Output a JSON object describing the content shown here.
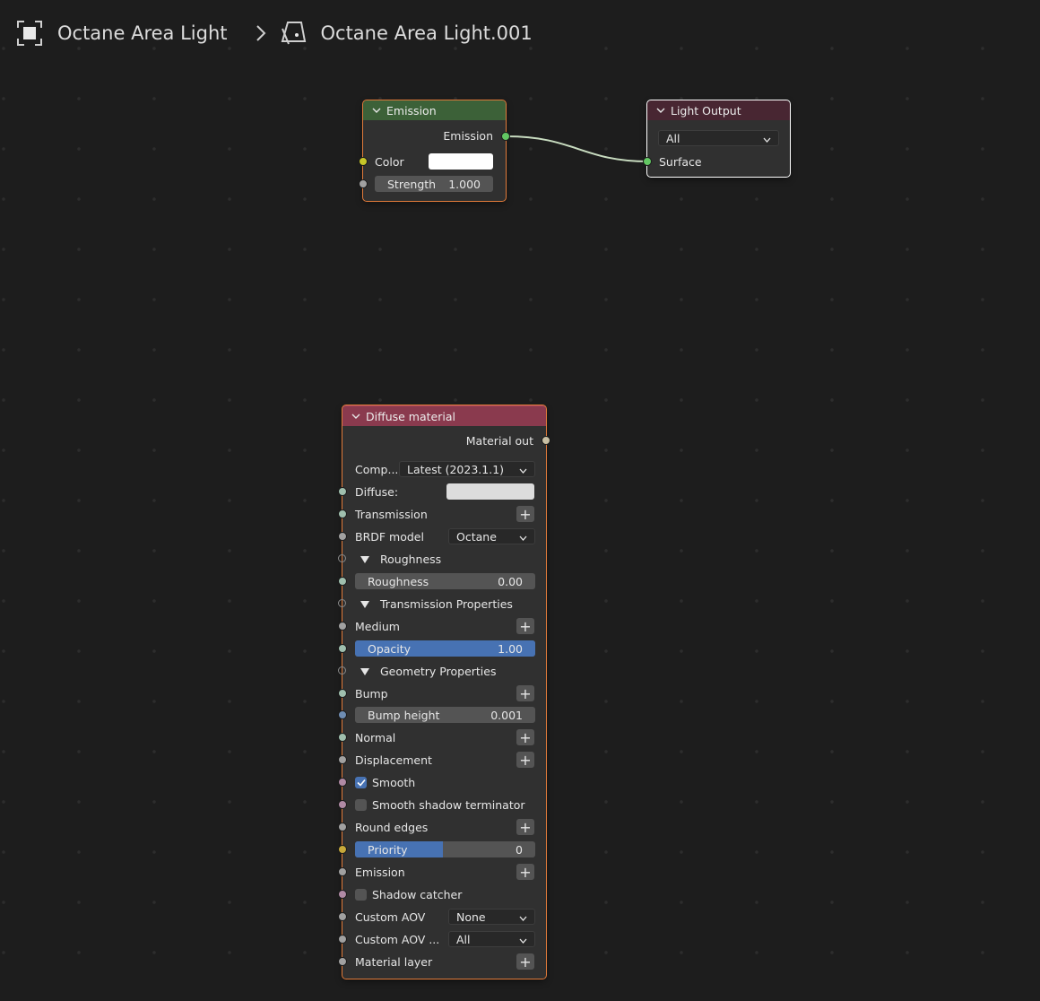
{
  "breadcrumb": {
    "object_name": "Octane Area Light",
    "data_name": "Octane Area Light.001"
  },
  "colors": {
    "emission_header": "#3c6138",
    "output_header": "#482632",
    "material_header": "#8a3a4e",
    "wire": "#c8dcc0",
    "accent": "#4772b3"
  },
  "emission_node": {
    "title": "Emission",
    "output_label": "Emission",
    "color_label": "Color",
    "strength_label": "Strength",
    "strength_value": "1.000"
  },
  "light_output_node": {
    "title": "Light Output",
    "target_value": "All",
    "surface_label": "Surface"
  },
  "diffuse_node": {
    "title": "Diffuse material",
    "output_label": "Material out",
    "comp_label": "Comp...",
    "comp_value": "Latest (2023.1.1)",
    "diffuse_label": "Diffuse:",
    "transmission_label": "Transmission",
    "brdf_label": "BRDF model",
    "brdf_value": "Octane",
    "roughness_panel": "Roughness",
    "roughness_label": "Roughness",
    "roughness_value": "0.00",
    "transmission_panel": "Transmission Properties",
    "medium_label": "Medium",
    "opacity_label": "Opacity",
    "opacity_value": "1.00",
    "opacity_fraction": 1.0,
    "geometry_panel": "Geometry Properties",
    "bump_label": "Bump",
    "bump_height_label": "Bump height",
    "bump_height_value": "0.001",
    "normal_label": "Normal",
    "displacement_label": "Displacement",
    "smooth_label": "Smooth",
    "smooth_checked": true,
    "smooth_shadow_label": "Smooth shadow terminator",
    "smooth_shadow_checked": false,
    "round_edges_label": "Round edges",
    "priority_label": "Priority",
    "priority_value": "0",
    "priority_fraction": 0.49,
    "emission_label": "Emission",
    "shadow_catcher_label": "Shadow catcher",
    "shadow_catcher_checked": false,
    "custom_aov_label": "Custom AOV",
    "custom_aov_value": "None",
    "custom_aov2_label": "Custom AOV ...",
    "custom_aov2_value": "All",
    "material_layer_label": "Material layer"
  }
}
